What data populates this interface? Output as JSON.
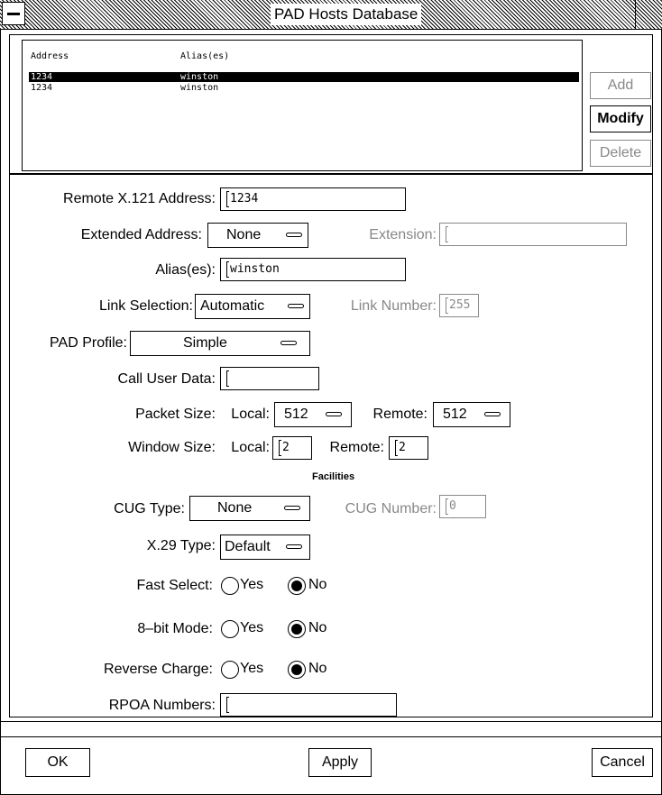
{
  "window": {
    "title": "PAD Hosts Database"
  },
  "hosts_list": {
    "headers": {
      "address": "Address",
      "aliases": "Alias(es)"
    },
    "rows": [
      {
        "address": "1234",
        "alias": "winston",
        "selected": true
      },
      {
        "address": "1234",
        "alias": "winston",
        "selected": false
      }
    ]
  },
  "list_buttons": {
    "add": "Add",
    "modify": "Modify",
    "delete": "Delete"
  },
  "form": {
    "remote_address_label": "Remote X.121 Address:",
    "remote_address_value": "1234",
    "extended_address_label": "Extended Address:",
    "extended_address_value": "None",
    "extension_label": "Extension:",
    "extension_value": "",
    "aliases_label": "Alias(es):",
    "aliases_value": "winston",
    "link_selection_label": "Link Selection:",
    "link_selection_value": "Automatic",
    "link_number_label": "Link Number:",
    "link_number_value": "255",
    "pad_profile_label": "PAD Profile:",
    "pad_profile_value": "Simple",
    "call_user_data_label": "Call User Data:",
    "call_user_data_value": "",
    "packet_size_label": "Packet Size:",
    "packet_local_label": "Local:",
    "packet_local_value": "512",
    "packet_remote_label": "Remote:",
    "packet_remote_value": "512",
    "window_size_label": "Window Size:",
    "window_local_label": "Local:",
    "window_local_value": "2",
    "window_remote_label": "Remote:",
    "window_remote_value": "2",
    "facilities_heading": "Facilities",
    "cug_type_label": "CUG Type:",
    "cug_type_value": "None",
    "cug_number_label": "CUG Number:",
    "cug_number_value": "0",
    "x29_type_label": "X.29 Type:",
    "x29_type_value": "Default",
    "fast_select_label": "Fast Select:",
    "eight_bit_label": "8–bit Mode:",
    "reverse_charge_label": "Reverse Charge:",
    "yes_label": "Yes",
    "no_label": "No",
    "rpoa_label": "RPOA Numbers:",
    "rpoa_value": ""
  },
  "footer": {
    "ok": "OK",
    "apply": "Apply",
    "cancel": "Cancel"
  }
}
